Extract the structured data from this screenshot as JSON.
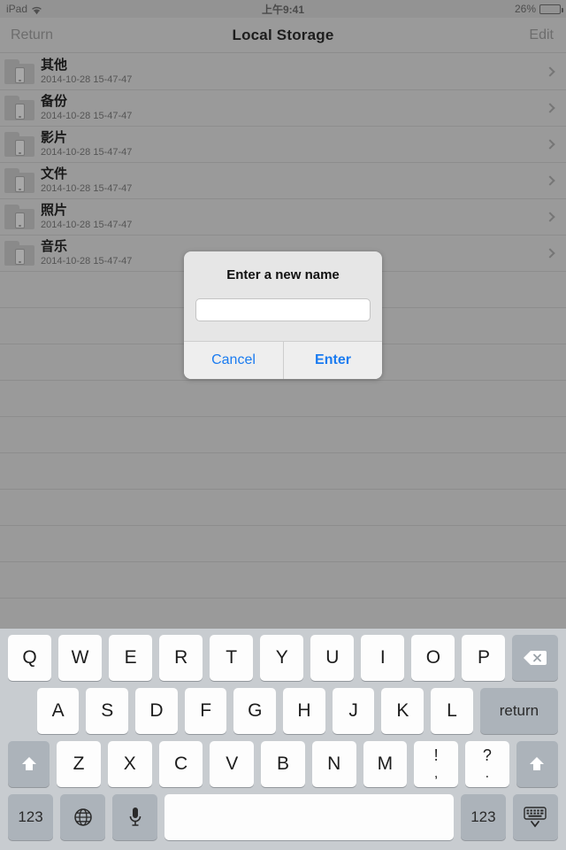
{
  "status_bar": {
    "device": "iPad",
    "wifi_icon": "wifi-icon",
    "time": "上午9:41",
    "battery_percent": "26%",
    "battery_level": 26
  },
  "nav_bar": {
    "back_label": "Return",
    "title": "Local Storage",
    "edit_label": "Edit"
  },
  "list": {
    "items": [
      {
        "title": "其他",
        "subtitle": "2014-10-28 15-47-47",
        "icon": "folder-device-icon",
        "accessory": "chevron-right-icon"
      },
      {
        "title": "备份",
        "subtitle": "2014-10-28 15-47-47",
        "icon": "folder-device-icon",
        "accessory": "chevron-right-icon"
      },
      {
        "title": "影片",
        "subtitle": "2014-10-28 15-47-47",
        "icon": "folder-device-icon",
        "accessory": "chevron-right-icon"
      },
      {
        "title": "文件",
        "subtitle": "2014-10-28 15-47-47",
        "icon": "folder-device-icon",
        "accessory": "chevron-right-icon"
      },
      {
        "title": "照片",
        "subtitle": "2014-10-28 15-47-47",
        "icon": "folder-device-icon",
        "accessory": "chevron-right-icon"
      },
      {
        "title": "音乐",
        "subtitle": "2014-10-28 15-47-47",
        "icon": "folder-device-icon",
        "accessory": "chevron-right-icon"
      }
    ],
    "empty_row_count": 9
  },
  "alert": {
    "title": "Enter a new name",
    "input_value": "",
    "input_placeholder": "",
    "cancel_label": "Cancel",
    "confirm_label": "Enter",
    "accent_color": "#1a7bf0"
  },
  "keyboard": {
    "row1": [
      "Q",
      "W",
      "E",
      "R",
      "T",
      "Y",
      "U",
      "I",
      "O",
      "P"
    ],
    "backspace_icon": "backspace-icon",
    "row2": [
      "A",
      "S",
      "D",
      "F",
      "G",
      "H",
      "J",
      "K",
      "L"
    ],
    "return_label": "return",
    "row3": [
      "Z",
      "X",
      "C",
      "V",
      "B",
      "N",
      "M"
    ],
    "punct1_top": "!",
    "punct1_bottom": ",",
    "punct2_top": "?",
    "punct2_bottom": ".",
    "shift_icon": "shift-icon",
    "numeric_label": "123",
    "globe_icon": "globe-icon",
    "mic_icon": "microphone-icon",
    "space_label": "",
    "hide_keyboard_icon": "hide-keyboard-icon"
  },
  "colors": {
    "screen_background": "#9a9a9a",
    "keyboard_background": "#c8ccd0",
    "key_light": "#fdfdfd",
    "key_dark": "#acb3ba",
    "alert_background": "#e6e6e6",
    "accent_blue": "#1a7bf0"
  }
}
